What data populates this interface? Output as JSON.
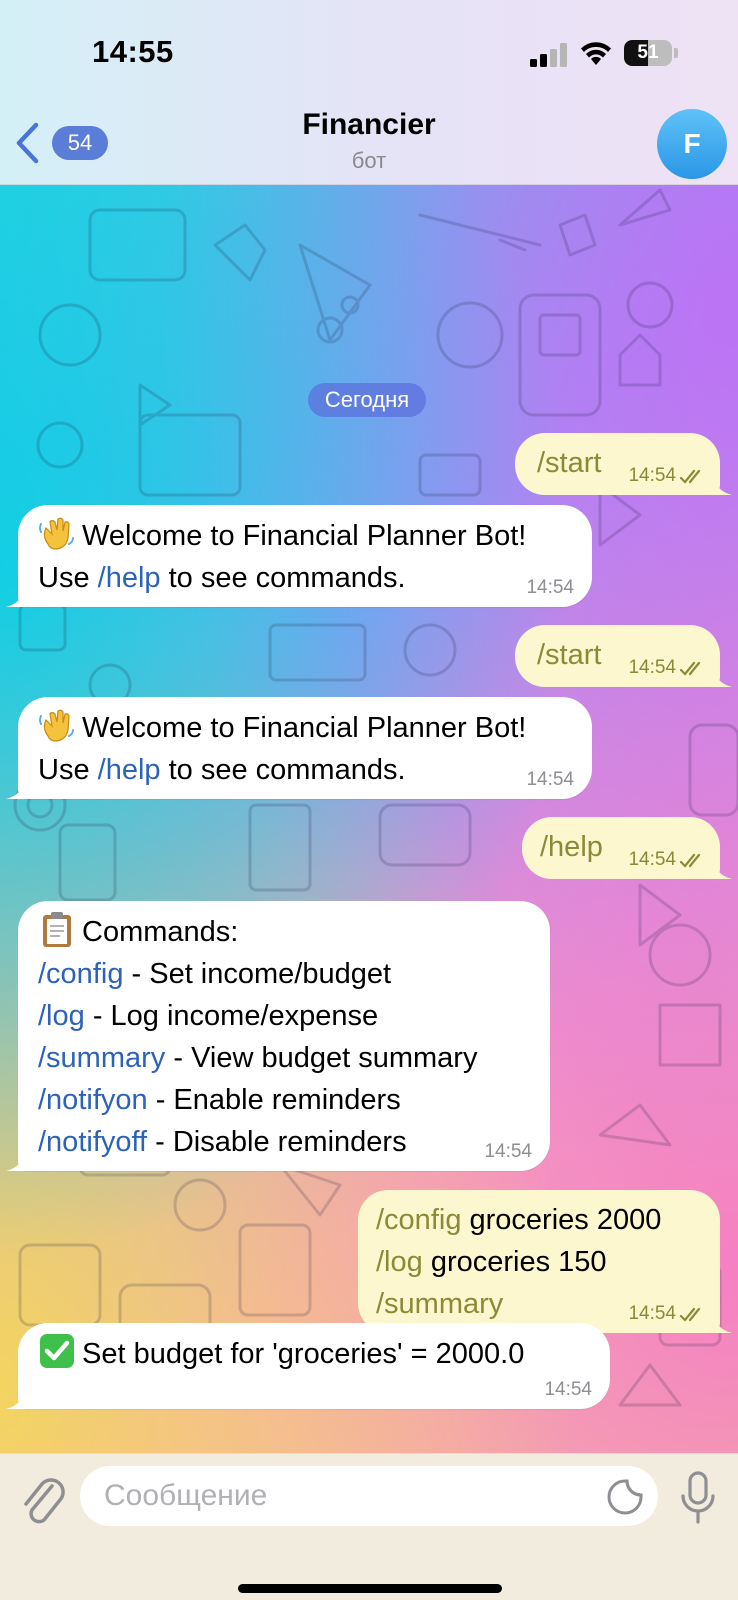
{
  "status_bar": {
    "time": "14:55",
    "battery_label": "51",
    "battery_level": 0.51,
    "signal_bars_active": 2,
    "signal_bars_total": 4
  },
  "header": {
    "back_count": "54",
    "title": "Financier",
    "subtitle": "бот",
    "avatar_letter": "F",
    "avatar_color": "#3aa3ee"
  },
  "date_divider": "Сегодня",
  "messages": {
    "m1": {
      "text": "/start",
      "time": "14:54"
    },
    "m2": {
      "line1": "Welcome to Financial Planner Bot!",
      "line2_pre": "Use ",
      "line2_cmd": "/help",
      "line2_post": " to see commands.",
      "time": "14:54",
      "emoji": "waving-hand"
    },
    "m3": {
      "text": "/start",
      "time": "14:54"
    },
    "m4": {
      "line1": "Welcome to Financial Planner Bot!",
      "line2_pre": "Use ",
      "line2_cmd": "/help",
      "line2_post": " to see commands.",
      "time": "14:54",
      "emoji": "waving-hand"
    },
    "m5": {
      "text": "/help",
      "time": "14:54"
    },
    "m6": {
      "heading": "Commands:",
      "emoji": "clipboard",
      "items": [
        {
          "cmd": "/config",
          "desc": " - Set income/budget"
        },
        {
          "cmd": "/log",
          "desc": " - Log income/expense"
        },
        {
          "cmd": "/summary",
          "desc": " - View budget summary"
        },
        {
          "cmd": "/notifyon",
          "desc": " - Enable reminders"
        },
        {
          "cmd": "/notifyoff",
          "desc": " - Disable reminders"
        }
      ],
      "time": "14:54"
    },
    "m7": {
      "lines": [
        {
          "cmd": "/config",
          "rest": " groceries 2000"
        },
        {
          "cmd": "/log",
          "rest": " groceries 150"
        },
        {
          "cmd": "/summary",
          "rest": ""
        }
      ],
      "time": "14:54"
    },
    "m8": {
      "text": "Set budget for 'groceries' = 2000.0",
      "time": "14:54",
      "emoji": "check-mark-button"
    }
  },
  "composer": {
    "placeholder": "Сообщение"
  },
  "colors": {
    "incoming_bubble": "#ffffff",
    "outgoing_bubble": "#fcf7cf",
    "outgoing_text": "#8c8a37",
    "command_link": "#2c63b8",
    "date_chip": "#5c70dc"
  }
}
